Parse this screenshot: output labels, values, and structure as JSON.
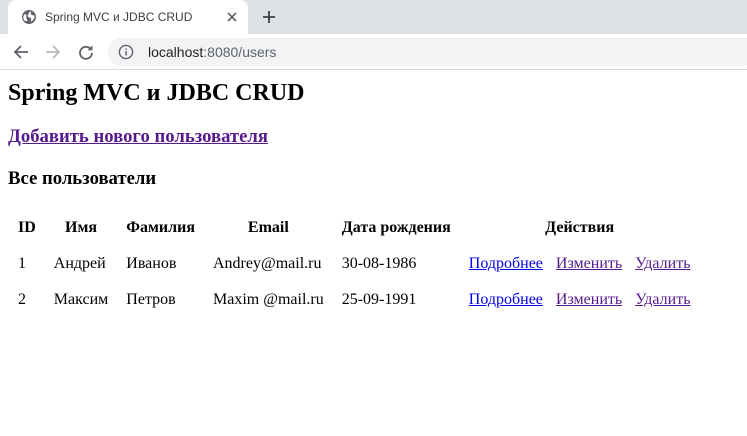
{
  "browser": {
    "tab_title": "Spring MVC и JDBC CRUD",
    "url_host": "localhost",
    "url_path": ":8080/users",
    "icons": {
      "favicon": "globe-icon",
      "tab_close": "close-icon",
      "new_tab": "plus-icon",
      "back": "arrow-left-icon",
      "forward": "arrow-right-icon",
      "reload": "reload-icon",
      "site_info": "info-icon"
    }
  },
  "page": {
    "title": "Spring MVC и JDBC CRUD",
    "add_user_link": "Добавить нового пользователя",
    "section_title": "Все пользователи",
    "table": {
      "headers": {
        "id": "ID",
        "first_name": "Имя",
        "last_name": "Фамилия",
        "email": "Email",
        "birth_date": "Дата рождения",
        "actions": "Действия"
      },
      "rows": [
        {
          "id": "1",
          "first_name": "Андрей",
          "last_name": "Иванов",
          "email": "Andrey@mail.ru",
          "birth_date": "30-08-1986",
          "details": "Подробнее",
          "edit": "Изменить",
          "delete": "Удалить"
        },
        {
          "id": "2",
          "first_name": "Максим",
          "last_name": "Петров",
          "email": "Maxim @mail.ru",
          "birth_date": "25-09-1991",
          "details": "Подробнее",
          "edit": "Изменить",
          "delete": "Удалить"
        }
      ]
    }
  },
  "colors": {
    "link_unvisited": "#0000ee",
    "link_visited": "#551a8b",
    "tabstrip_bg": "#dee1e6",
    "omnibox_bg": "#f1f3f4"
  }
}
